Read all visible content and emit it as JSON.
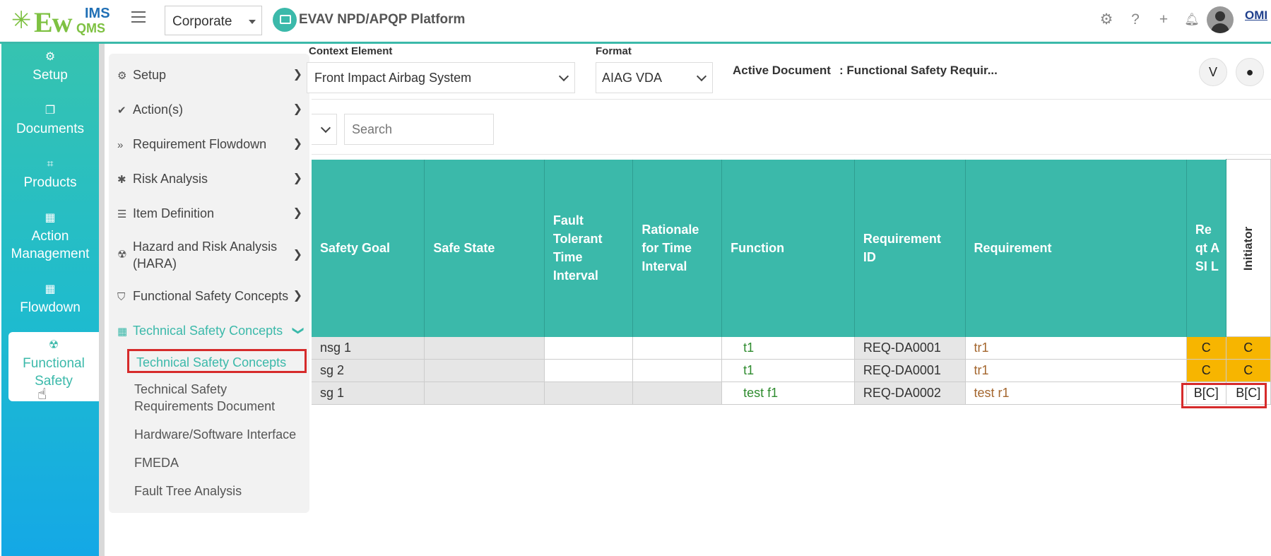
{
  "topbar": {
    "logo_main": "Ew",
    "logo_ims": "IMS",
    "logo_qms": "QMS",
    "org_select": "Corporate",
    "platform_title": "EVAV NPD/APQP Platform",
    "icons": [
      "gear-icon",
      "help-icon",
      "plus-icon",
      "bell-icon",
      "avatar"
    ],
    "corner_logo": "OMI"
  },
  "leftnav": {
    "items": [
      {
        "label": "Setup",
        "icon": "gears-icon"
      },
      {
        "label": "Documents",
        "icon": "copy-icon"
      },
      {
        "label": "Products",
        "icon": "product-icon"
      },
      {
        "label": "Action Management",
        "icon": "building-icon"
      },
      {
        "label": "Flowdown",
        "icon": "building-icon"
      },
      {
        "label": "Functional Safety",
        "icon": "radiation-icon",
        "active": true
      }
    ]
  },
  "flyout": {
    "items": [
      {
        "label": "Setup"
      },
      {
        "label": "Action(s)"
      },
      {
        "label": "Requirement Flowdown"
      },
      {
        "label": "Risk Analysis"
      },
      {
        "label": "Item Definition"
      },
      {
        "label": "Hazard and Risk Analysis (HARA)"
      },
      {
        "label": "Functional Safety Concepts"
      },
      {
        "label": "Technical Safety Concepts",
        "expanded": true
      }
    ],
    "subitems": [
      {
        "label": "Technical Safety Concepts",
        "current": true
      },
      {
        "label": "Technical Safety Requirements Document"
      },
      {
        "label": "Hardware/Software Interface"
      },
      {
        "label": "FMEDA"
      },
      {
        "label": "Fault Tree Analysis"
      }
    ]
  },
  "header": {
    "context_label": "Context Element",
    "context_value": "Front Impact Airbag System",
    "format_label": "Format",
    "format_value": "AIAG VDA",
    "active_doc_label": "Active Document",
    "active_doc_value": ": Functional Safety Requir..."
  },
  "filter": {
    "search_placeholder": "Search"
  },
  "table": {
    "columns": [
      "Safety Goal",
      "Safe State",
      "Fault Tolerant Time Interval",
      "Rationale for Time Interval",
      "Function",
      "Requirement ID",
      "Requirement",
      "Re qt ASI L",
      "Initiator"
    ],
    "rows": [
      {
        "safety_goal": "nsg 1",
        "safe_state": "",
        "ftti": "",
        "rationale": "",
        "function": "t1",
        "req_id": "REQ-DA0001",
        "requirement": "tr1",
        "asil": "C",
        "initiator": "C"
      },
      {
        "safety_goal": "sg 2",
        "safe_state": "",
        "ftti": "",
        "rationale": "",
        "function": "t1",
        "req_id": "REQ-DA0001",
        "requirement": "tr1",
        "asil": "C",
        "initiator": "C"
      },
      {
        "safety_goal": "sg 1",
        "safe_state": "",
        "ftti": "",
        "rationale": "",
        "function": "test f1",
        "req_id": "REQ-DA0002",
        "requirement": "test r1",
        "asil": "B[C]",
        "initiator": "B[C]"
      }
    ]
  },
  "colors": {
    "accent": "#3bb9aa",
    "asil_highlight": "#f7b500",
    "annotation_red": "#d62b2b"
  }
}
